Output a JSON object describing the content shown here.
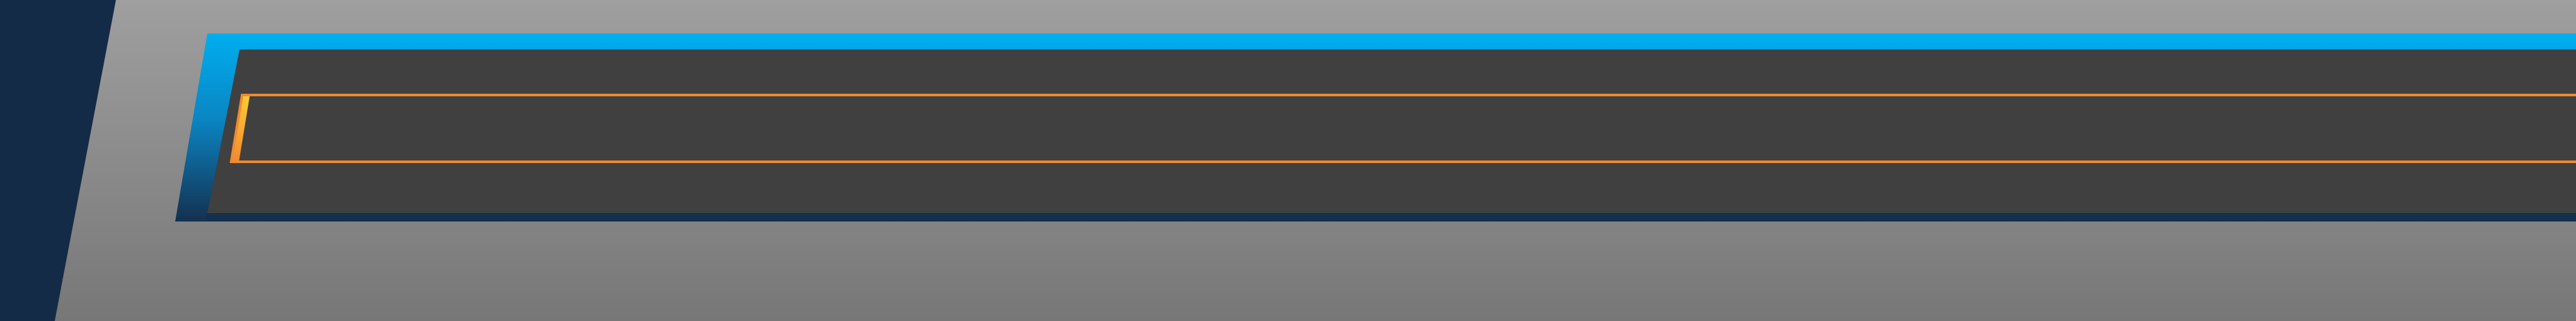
{
  "theme": {
    "background_top": "#9f9f9f",
    "background_bottom": "#777777",
    "side_wedge": "#132b47",
    "accent_blue": "#00aeef",
    "panel_edge_navy": "#14304f",
    "panel_fill": "#404040",
    "input_border_orange": "#f08a30",
    "input_tab_yellow": "#ffcc33"
  },
  "panel": {
    "icons": {
      "left_wedge": "shape",
      "blue_trim": "shape"
    }
  },
  "input_bar": {
    "value": "",
    "placeholder": ""
  }
}
